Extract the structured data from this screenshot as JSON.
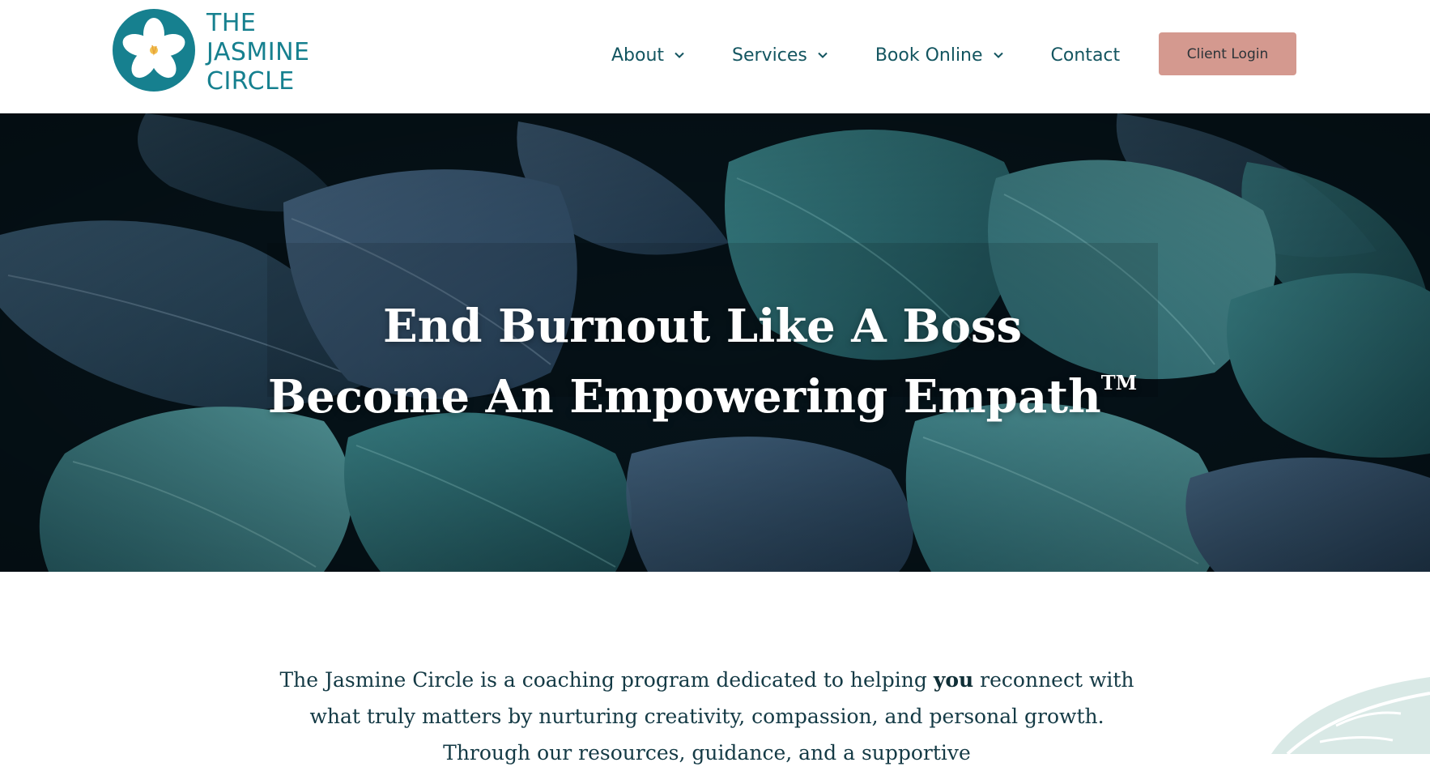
{
  "brand": {
    "name_line1": "THE",
    "name_line2": "JASMINE",
    "name_line3": "CIRCLE",
    "colors": {
      "teal": "#16808f",
      "navy": "#135560",
      "rose": "#d4998f"
    }
  },
  "nav": {
    "items": [
      {
        "label": "About",
        "icon": "chevron-down-icon"
      },
      {
        "label": "Services",
        "icon": "chevron-down-icon"
      },
      {
        "label": "Book Online",
        "icon": "chevron-down-icon"
      },
      {
        "label": "Contact"
      }
    ],
    "login_label": "Client Login"
  },
  "hero": {
    "line1": "End Burnout Like A Boss",
    "line2": "Become An Empowering Empath",
    "trademark": "TM"
  },
  "intro": {
    "part1": "The Jasmine Circle is a coaching program dedicated to helping ",
    "emphasis": "you",
    "part2": " reconnect with what truly matters by nurturing creativity, compassion, and personal growth. Through our resources, guidance, and a supportive"
  }
}
